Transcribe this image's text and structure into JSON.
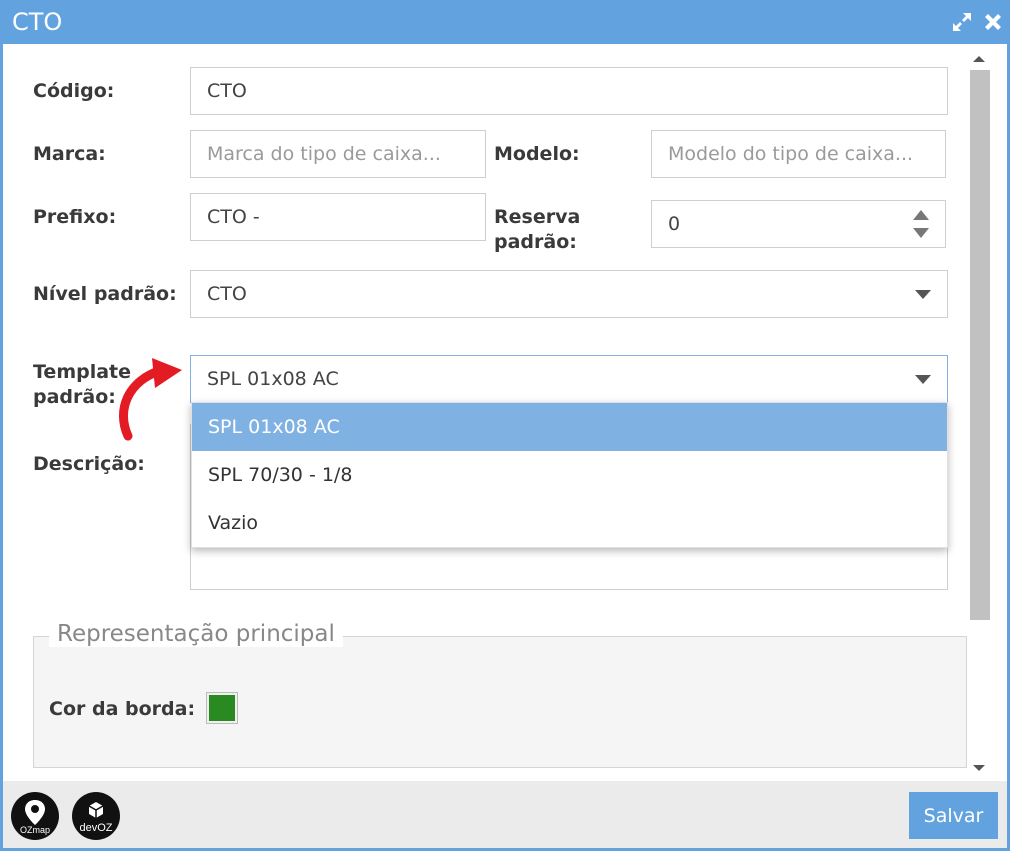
{
  "window": {
    "title": "CTO",
    "expand_icon": "expand-arrows-icon",
    "close_icon": "close-icon"
  },
  "form": {
    "codigo": {
      "label": "Código:",
      "value": "CTO"
    },
    "marca": {
      "label": "Marca:",
      "placeholder": "Marca do tipo de caixa..."
    },
    "modelo": {
      "label": "Modelo:",
      "placeholder": "Modelo do tipo de caixa..."
    },
    "prefixo": {
      "label": "Prefixo:",
      "value": "CTO -"
    },
    "reserva": {
      "label_line1": "Reserva",
      "label_line2": "padrão:",
      "value": "0"
    },
    "nivel": {
      "label": "Nível padrão:",
      "value": "CTO"
    },
    "template": {
      "label_line1": "Template",
      "label_line2": "padrão:",
      "value": "SPL 01x08 AC",
      "options": [
        "SPL 01x08 AC",
        "SPL 70/30 - 1/8",
        "Vazio"
      ]
    },
    "descricao": {
      "label": "Descrição:"
    }
  },
  "representacao": {
    "legend": "Representação principal",
    "cor_borda_label": "Cor da borda:",
    "cor_borda_value": "#2a8a22"
  },
  "footer": {
    "logo1_text": "OZmap",
    "logo2_text": "devOZ",
    "save_label": "Salvar"
  },
  "colors": {
    "accent": "#62a3df",
    "dropdown_highlight": "#7fb1e2",
    "annotation_arrow": "#e31b23"
  }
}
